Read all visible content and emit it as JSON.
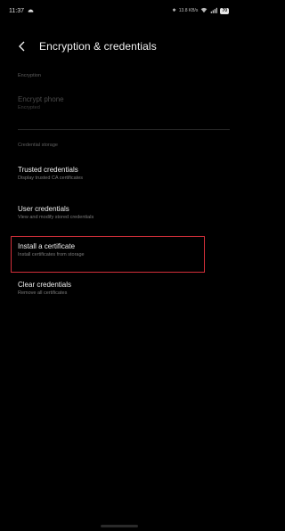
{
  "status_bar": {
    "time": "11:37",
    "network_speed": "13.8 KB/s",
    "battery": "70"
  },
  "header": {
    "title": "Encryption & credentials"
  },
  "sections": {
    "encryption": {
      "label": "Encryption",
      "items": [
        {
          "title": "Encrypt phone",
          "subtitle": "Encrypted"
        }
      ]
    },
    "credential_storage": {
      "label": "Credential storage",
      "items": [
        {
          "title": "Trusted credentials",
          "subtitle": "Display trusted CA certificates"
        },
        {
          "title": "User credentials",
          "subtitle": "View and modify stored credentials"
        },
        {
          "title": "Install a certificate",
          "subtitle": "Install certificates from storage"
        },
        {
          "title": "Clear credentials",
          "subtitle": "Remove all certificates"
        }
      ]
    }
  },
  "colors": {
    "background": "#000000",
    "highlight": "#d32f3a"
  }
}
